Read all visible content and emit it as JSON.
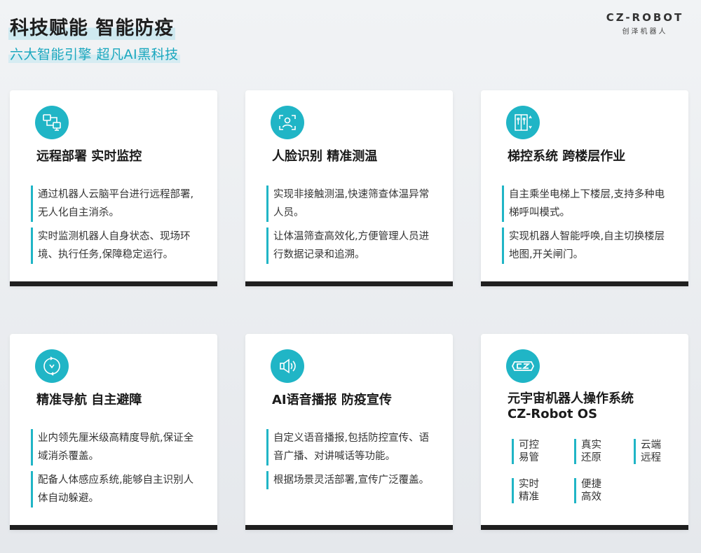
{
  "header": {
    "title": "科技赋能  智能防疫",
    "subtitle": "六大智能引擎  超凡AI黑科技"
  },
  "logo": {
    "main": "CZ-ROBOT",
    "sub": "创泽机器人"
  },
  "accent_color": "#20b5c6",
  "cards": [
    {
      "icon": "remote-monitor-icon",
      "title": "远程部署  实时监控",
      "desc1": "通过机器人云脑平台进行远程部署,无人化自主消杀。",
      "desc2": "实时监测机器人自身状态、现场环境、执行任务,保障稳定运行。"
    },
    {
      "icon": "face-scan-icon",
      "title": "人脸识别  精准测温",
      "desc1": "实现非接触测温,快速筛查体温异常人员。",
      "desc2": "让体温筛查高效化,方便管理人员进行数据记录和追溯。"
    },
    {
      "icon": "elevator-icon",
      "title": "梯控系统  跨楼层作业",
      "desc1": "自主乘坐电梯上下楼层,支持多种电梯呼叫模式。",
      "desc2": "实现机器人智能呼唤,自主切换楼层地图,开关闸门。"
    },
    {
      "icon": "navigation-icon",
      "title": "精准导航  自主避障",
      "desc1": "业内领先厘米级高精度导航,保证全域消杀覆盖。",
      "desc2": "配备人体感应系统,能够自主识别人体自动躲避。"
    },
    {
      "icon": "speaker-icon",
      "title": "AI语音播报  防疫宣传",
      "desc1": "自定义语音播报,包括防控宣传、语音广播、对讲喊话等功能。",
      "desc2": "根据场景灵活部署,宣传广泛覆盖。"
    },
    {
      "icon": "cz-logo-icon",
      "title_line1": "元宇宙机器人操作系统",
      "title_line2": "CZ-Robot OS",
      "features": [
        {
          "l1": "可控",
          "l2": "易管"
        },
        {
          "l1": "真实",
          "l2": "还原"
        },
        {
          "l1": "云端",
          "l2": "远程"
        },
        {
          "l1": "实时",
          "l2": "精准"
        },
        {
          "l1": "便捷",
          "l2": "高效"
        }
      ]
    }
  ]
}
